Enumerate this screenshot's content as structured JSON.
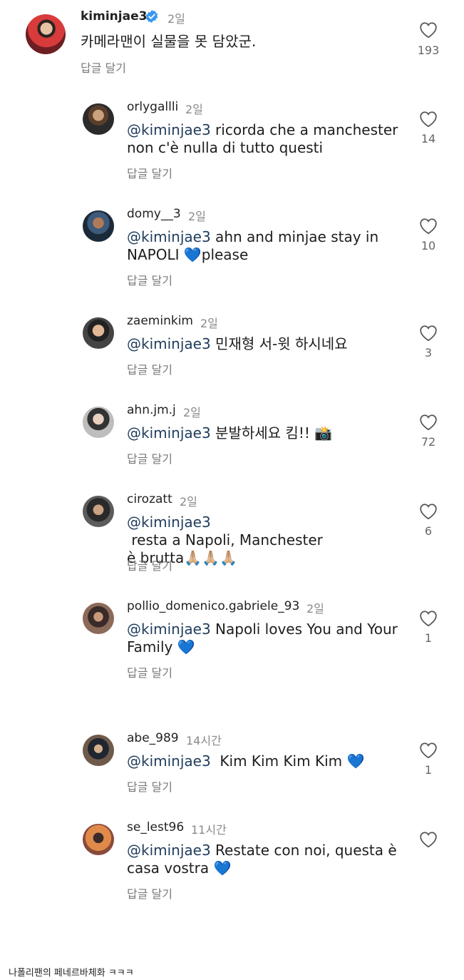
{
  "main_comment": {
    "user": "kiminjae3",
    "time": "2일",
    "text": "카메라맨이 실물을 못 담았군.",
    "reply_label": "답글 달기",
    "likes": "193",
    "verified": true
  },
  "replies": [
    {
      "user": "orlygallli",
      "time": "2일",
      "mention": "@kiminjae3",
      "line1": " ricorda che a manchester",
      "line2": "non c'è nulla di tutto questi",
      "reply_label": "답글 달기",
      "likes": "14"
    },
    {
      "user": "domy__3",
      "time": "2일",
      "mention": "@kiminjae3",
      "line1": " ahn and minjae stay in",
      "line2": "NAPOLI 💙please",
      "reply_label": "답글 달기",
      "likes": "10"
    },
    {
      "user": "zaeminkim",
      "time": "2일",
      "mention": "@kiminjae3",
      "line1": " 민재형 서-윗 하시네요",
      "line2": "",
      "reply_label": "답글 달기",
      "likes": "3"
    },
    {
      "user": "ahn.jm.j",
      "time": "2일",
      "mention": "@kiminjae3",
      "line1": " 분발하세요 킴!! 📸",
      "line2": "",
      "reply_label": "답글 달기",
      "likes": "72"
    },
    {
      "user": "cirozatt",
      "time": "2일",
      "mention": "@kiminjae3",
      "line1": " resta a Napoli, Manchester",
      "line2": "è brutta🙏🏼🙏🏼🙏🏼",
      "reply_label": "답글 달기",
      "likes": "6"
    },
    {
      "user": "pollio_domenico.gabriele_93",
      "time": "2일",
      "mention": "@kiminjae3",
      "line1": " Napoli loves You and Your",
      "line2": "Family 💙",
      "reply_label": "답글 달기",
      "likes": "1"
    },
    {
      "user": "abe_989",
      "time": "14시간",
      "mention": "@kiminjae3",
      "line1": "  Kim Kim Kim Kim 💙",
      "line2": "",
      "reply_label": "답글 달기",
      "likes": "1"
    },
    {
      "user": "se_lest96",
      "time": "11시간",
      "mention": "@kiminjae3",
      "line1": " Restate con noi, questa è",
      "line2": "casa vostra 💙",
      "reply_label": "답글 달기",
      "likes": ""
    }
  ],
  "caption": "나폴리팬의 페네르바체화 ㅋㅋㅋ",
  "colors": {
    "mention": "#1f3c5c",
    "verified": "#3897f0",
    "muted": "#8a8a8a"
  },
  "icons": {
    "like": "heart-outline-icon",
    "verified": "verified-badge-icon"
  }
}
